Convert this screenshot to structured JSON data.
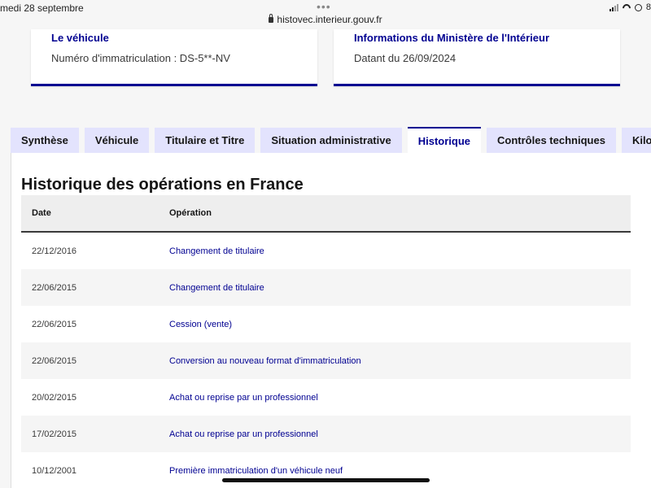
{
  "statusbar": {
    "date": "medi 28 septembre",
    "url": "histovec.interieur.gouv.fr",
    "dots": "•••",
    "battery": "8"
  },
  "cards": {
    "vehicle": {
      "title": "Le véhicule",
      "text": "Numéro d'immatriculation : DS-5**-NV"
    },
    "ministry": {
      "title": "Informations du Ministère de l'Intérieur",
      "text": "Datant du 26/09/2024"
    }
  },
  "tabs": [
    {
      "label": "Synthèse",
      "active": false
    },
    {
      "label": "Véhicule",
      "active": false
    },
    {
      "label": "Titulaire et Titre",
      "active": false
    },
    {
      "label": "Situation administrative",
      "active": false
    },
    {
      "label": "Historique",
      "active": true
    },
    {
      "label": "Contrôles techniques",
      "active": false
    },
    {
      "label": "Kilo",
      "active": false
    }
  ],
  "section": {
    "title": "Historique des opérations en France"
  },
  "table": {
    "headers": {
      "date": "Date",
      "operation": "Opération"
    },
    "rows": [
      {
        "date": "22/12/2016",
        "operation": "Changement de titulaire"
      },
      {
        "date": "22/06/2015",
        "operation": "Changement de titulaire"
      },
      {
        "date": "22/06/2015",
        "operation": "Cession (vente)"
      },
      {
        "date": "22/06/2015",
        "operation": "Conversion au nouveau format d'immatriculation"
      },
      {
        "date": "20/02/2015",
        "operation": "Achat ou reprise par un professionnel"
      },
      {
        "date": "17/02/2015",
        "operation": "Achat ou reprise par un professionnel"
      },
      {
        "date": "10/12/2001",
        "operation": "Première immatriculation d'un véhicule neuf"
      }
    ]
  },
  "colors": {
    "accent": "#000091",
    "tab_bg": "#e3e3fd",
    "row_alt": "#f5f5f5"
  }
}
